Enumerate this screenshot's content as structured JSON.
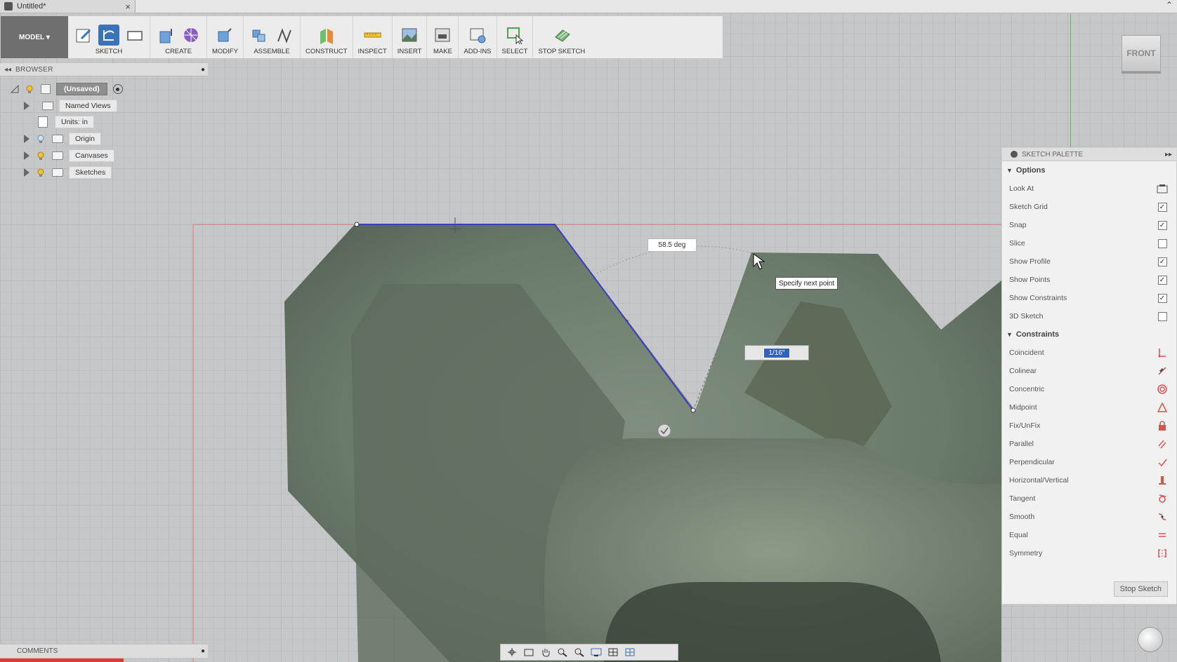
{
  "window": {
    "title": "Untitled*"
  },
  "toolbar": {
    "model_label": "MODEL",
    "groups": [
      {
        "label": "SKETCH"
      },
      {
        "label": "CREATE"
      },
      {
        "label": "MODIFY"
      },
      {
        "label": "ASSEMBLE"
      },
      {
        "label": "CONSTRUCT"
      },
      {
        "label": "INSPECT"
      },
      {
        "label": "INSERT"
      },
      {
        "label": "MAKE"
      },
      {
        "label": "ADD-INS"
      },
      {
        "label": "SELECT"
      },
      {
        "label": "STOP SKETCH"
      }
    ]
  },
  "viewcube": {
    "label": "FRONT"
  },
  "browser": {
    "title": "BROWSER",
    "root": "(Unsaved)",
    "items": [
      {
        "label": "Named Views"
      },
      {
        "label": "Units: in"
      },
      {
        "label": "Origin"
      },
      {
        "label": "Canvases"
      },
      {
        "label": "Sketches"
      }
    ]
  },
  "canvas": {
    "angle_dim": "58.5 deg",
    "tooltip": "Specify next point",
    "length_input": "1/16\""
  },
  "palette": {
    "title": "SKETCH PALETTE",
    "options_header": "Options",
    "options": [
      {
        "label": "Look At",
        "control": "icon",
        "icon": "look-at-icon"
      },
      {
        "label": "Sketch Grid",
        "control": "checkbox",
        "checked": true
      },
      {
        "label": "Snap",
        "control": "checkbox",
        "checked": true
      },
      {
        "label": "Slice",
        "control": "checkbox",
        "checked": false
      },
      {
        "label": "Show Profile",
        "control": "checkbox",
        "checked": true
      },
      {
        "label": "Show Points",
        "control": "checkbox",
        "checked": true
      },
      {
        "label": "Show Constraints",
        "control": "checkbox",
        "checked": true
      },
      {
        "label": "3D Sketch",
        "control": "checkbox",
        "checked": false
      }
    ],
    "constraints_header": "Constraints",
    "constraints": [
      {
        "label": "Coincident",
        "icon": "coincident-icon"
      },
      {
        "label": "Colinear",
        "icon": "colinear-icon"
      },
      {
        "label": "Concentric",
        "icon": "concentric-icon"
      },
      {
        "label": "Midpoint",
        "icon": "midpoint-icon"
      },
      {
        "label": "Fix/UnFix",
        "icon": "lock-icon"
      },
      {
        "label": "Parallel",
        "icon": "parallel-icon"
      },
      {
        "label": "Perpendicular",
        "icon": "perpendicular-icon"
      },
      {
        "label": "Horizontal/Vertical",
        "icon": "horizontal-vertical-icon"
      },
      {
        "label": "Tangent",
        "icon": "tangent-icon"
      },
      {
        "label": "Smooth",
        "icon": "smooth-icon"
      },
      {
        "label": "Equal",
        "icon": "equal-icon"
      },
      {
        "label": "Symmetry",
        "icon": "symmetry-icon"
      }
    ],
    "stop_sketch": "Stop Sketch"
  },
  "comments": {
    "title": "COMMENTS"
  },
  "colors": {
    "accent": "#3a73b8",
    "constraint_red": "#d9534f",
    "sketch_line": "#3b3fbf"
  }
}
